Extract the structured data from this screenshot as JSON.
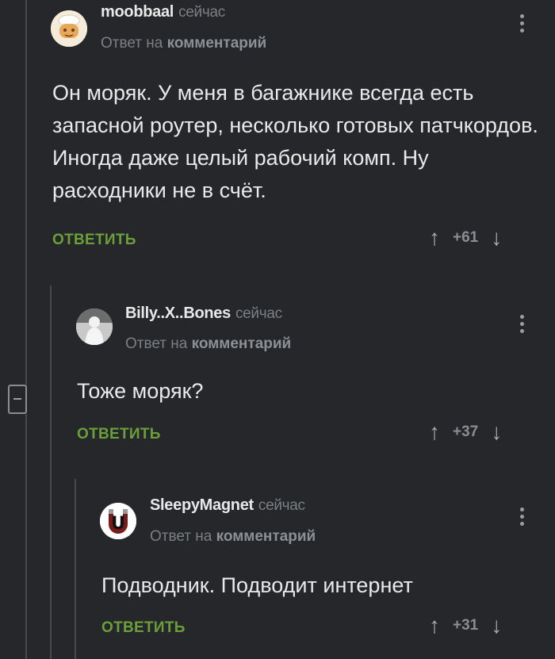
{
  "comments": [
    {
      "author": "moobbaal",
      "time": "сейчас",
      "reply_prefix": "Ответ на",
      "reply_target": "комментарий",
      "text": "Он моряк. У меня в багажнике всегда есть запасной роутер, несколько готовых патчкордов. Иногда даже целый рабочий комп. Ну расходники не в счёт.",
      "reply_label": "ОТВЕТИТЬ",
      "score": "+61",
      "up_icon": "arrow-up-icon",
      "down_icon": "arrow-down-icon"
    },
    {
      "author": "Billy..X..Bones",
      "time": "сейчас",
      "reply_prefix": "Ответ на",
      "reply_target": "комментарий",
      "text": "Тоже моряк?",
      "reply_label": "ОТВЕТИТЬ",
      "score": "+37",
      "up_icon": "arrow-up-icon",
      "down_icon": "arrow-down-icon"
    },
    {
      "author": "SleepyMagnet",
      "time": "сейчас",
      "reply_prefix": "Ответ на",
      "reply_target": "комментарий",
      "text": "Подводник. Подводит интернет",
      "reply_label": "ОТВЕТИТЬ",
      "score": "+31",
      "up_icon": "arrow-up-icon",
      "down_icon": "arrow-down-icon"
    }
  ],
  "colors": {
    "background": "#25272a",
    "reply_button": "#6b9f3a",
    "text": "#e9e9e9",
    "muted": "#7c7f83"
  }
}
